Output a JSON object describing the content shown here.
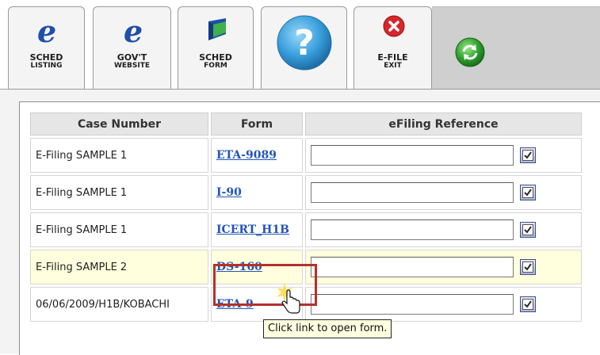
{
  "toolbar": {
    "tabs": [
      {
        "line1": "SCHED",
        "line2": "LISTING",
        "icon": "ie-e-icon"
      },
      {
        "line1": "GOV'T",
        "line2": "WEBSITE",
        "icon": "ie-e-icon"
      },
      {
        "line1": "SCHED",
        "line2": "FORM",
        "icon": "form-flag-icon"
      },
      {
        "line1": "",
        "line2": "",
        "icon": "help-icon"
      },
      {
        "line1": "E-FILE",
        "line2": "EXIT",
        "icon": "close-icon"
      }
    ],
    "refresh_icon": "refresh-icon",
    "icon_e_glyph": "e",
    "help_glyph": "?",
    "colors": {
      "help": "#3aa0dd",
      "close": "#d8262b",
      "refresh": "#2fa52f",
      "ie_e": "#1f4fa8"
    }
  },
  "table": {
    "headers": [
      "Case Number",
      "Form",
      "eFiling Reference"
    ],
    "rows": [
      {
        "case": "E-Filing SAMPLE 1",
        "form": "ETA-9089",
        "ref": ""
      },
      {
        "case": "E-Filing SAMPLE 1",
        "form": "I-90",
        "ref": ""
      },
      {
        "case": "E-Filing SAMPLE 1",
        "form": "ICERT_H1B",
        "ref": ""
      },
      {
        "case": "E-Filing SAMPLE 2",
        "form": "DS-160",
        "ref": ""
      },
      {
        "case": "06/06/2009/H1B/KOBACHI",
        "form": "ETA-9",
        "ref": ""
      }
    ]
  },
  "tooltip": "Click link to open form.",
  "colors": {
    "highlight_border": "#b3312d",
    "link": "#2355b8",
    "row_highlight": "#ffffdd"
  }
}
